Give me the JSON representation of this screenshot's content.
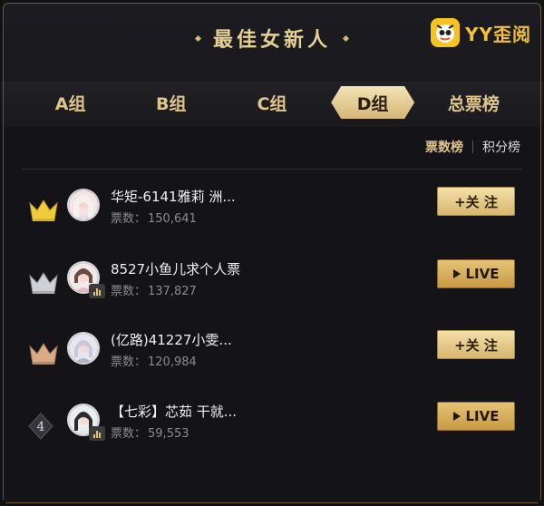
{
  "header": {
    "title": "最佳女新人"
  },
  "brand": {
    "name": "YY歪阅"
  },
  "tabs": [
    {
      "label": "A组",
      "active": false
    },
    {
      "label": "B组",
      "active": false
    },
    {
      "label": "C组",
      "active": false
    },
    {
      "label": "D组",
      "active": true
    },
    {
      "label": "总票榜",
      "active": false
    }
  ],
  "sort": {
    "votes_rank": "票数榜",
    "points_rank": "积分榜",
    "active": "votes_rank"
  },
  "rows": [
    {
      "rank": 1,
      "rank_icon": "gold-crown-icon",
      "name": "华矩-6141雅莉 洲...",
      "votes_label": "票数：",
      "votes": "150,641",
      "action": "+关 注",
      "action_type": "follow",
      "live": false
    },
    {
      "rank": 2,
      "rank_icon": "silver-crown-icon",
      "name": "8527小鱼儿求个人票",
      "votes_label": "票数：",
      "votes": "137,827",
      "action": "LIVE",
      "action_type": "live",
      "live": true
    },
    {
      "rank": 3,
      "rank_icon": "bronze-crown-icon",
      "name": "(亿路)41227小雯...",
      "votes_label": "票数：",
      "votes": "120,984",
      "action": "+关 注",
      "action_type": "follow",
      "live": false
    },
    {
      "rank": 4,
      "rank_icon": "rank-badge-icon",
      "rank_label": "4",
      "name": "【七彩】芯茹 干就...",
      "votes_label": "票数：",
      "votes": "59,553",
      "action": "LIVE",
      "action_type": "live",
      "live": true
    }
  ],
  "colors": {
    "gold": "#e0c48a",
    "accent_yellow": "#f2c13b",
    "background": "#141418"
  }
}
